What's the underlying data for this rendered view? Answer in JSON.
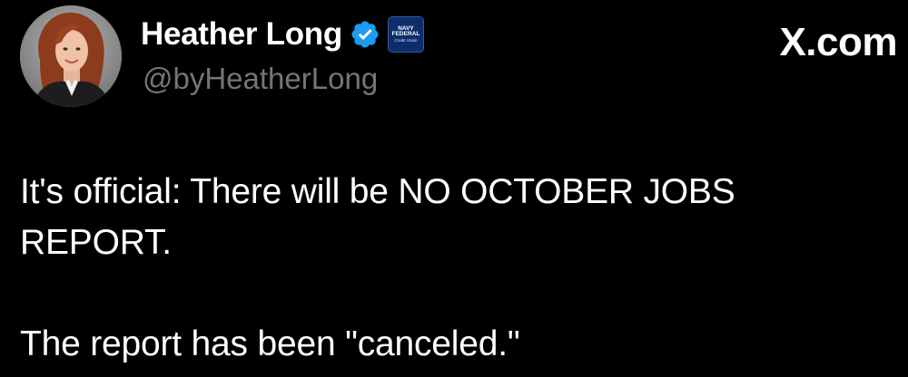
{
  "author": {
    "display_name": "Heather Long",
    "handle": "@byHeatherLong",
    "verified": true,
    "verified_color": "#1d9bf0",
    "affiliation_badge": {
      "line1": "NAVY",
      "line2": "FEDERAL",
      "line3": "Credit Union"
    }
  },
  "site": {
    "label": "X.com"
  },
  "tweet": {
    "paragraphs": [
      "It's official: There will be NO OCTOBER JOBS REPORT.",
      "The report has been \"canceled.\""
    ]
  },
  "colors": {
    "background": "#000000",
    "text": "#ffffff",
    "handle": "#71767b"
  }
}
